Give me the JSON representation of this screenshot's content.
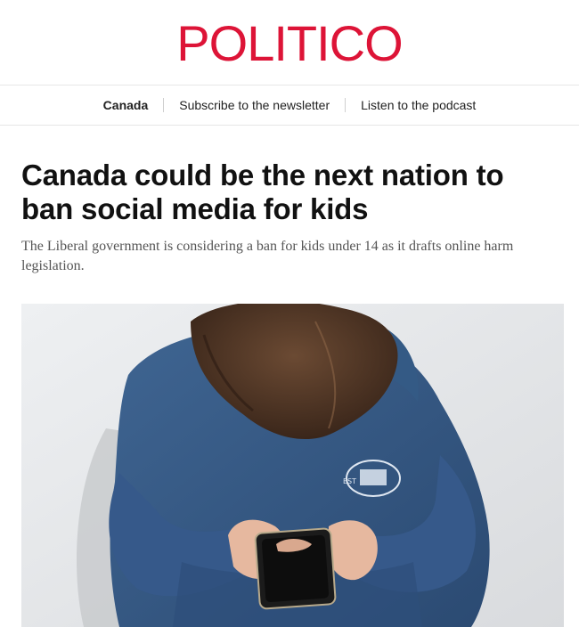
{
  "brand": {
    "logo_text": "POLITICO",
    "color": "#dd1437"
  },
  "nav": {
    "items": [
      {
        "label": "Canada",
        "active": true
      },
      {
        "label": "Subscribe to the newsletter"
      },
      {
        "label": "Listen to the podcast"
      }
    ]
  },
  "article": {
    "headline": "Canada could be the next nation to ban social media for kids",
    "dek": "The Liberal government is considering a ban for kids under 14 as it drafts online harm legislation."
  },
  "hero_image": {
    "alt_subject": "child in hoodie looking at smartphone",
    "hoodie_text": "EST"
  }
}
